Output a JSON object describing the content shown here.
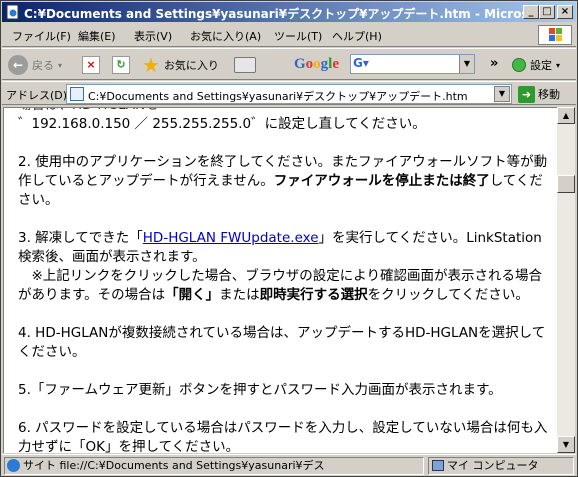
{
  "window": {
    "title": "C:¥Documents and Settings¥yasunari¥デスクトップ¥アップデート.htm - Microsoft Inter..."
  },
  "menu": {
    "items": [
      "ファイル(F)",
      "編集(E)",
      "表示(V)",
      "お気に入り(A)",
      "ツール(T)",
      "ヘルプ(H)"
    ]
  },
  "toolbar": {
    "back_label": "戻る",
    "favorites_label": "お気に入り",
    "google_label": "Google",
    "settings_label": "設定",
    "more": "»"
  },
  "address": {
    "label": "アドレス(D)",
    "url": "C:¥Documents and Settings¥yasunari¥デスクトップ¥アップデート.htm",
    "go_label": "移動"
  },
  "content": {
    "partial_top": "場合は、HD-HGLANを",
    "line_ip": "゛192.168.0.150 ／ 255.255.255.0゛に設定し直してください。",
    "step2_text": "2. 使用中のアプリケーションを終了してください。またファイアウォールソフト等が動作しているとアップデートが行えません。",
    "step2_bold": "ファイアウォールを停止または終了",
    "step2_end": "してください。",
    "step3_pre": "3. 解凍してできた「",
    "step3_link": "HD-HGLAN FWUpdate.exe",
    "step3_post": "」を実行してください。LinkStation検索後、画面が表示されます。",
    "step3_note_a": "　※上記リンクをクリックした場合、ブラウザの設定により確認画面が表示される場合があります。その場合は",
    "step3_note_b1": "「開く」",
    "step3_note_c": "または",
    "step3_note_b2": "即時実行する選択",
    "step3_note_d": "をクリックしてください。",
    "step4": "4. HD-HGLANが複数接続されている場合は、アップデートするHD-HGLANを選択してください。",
    "step5": "5.「ファームウェア更新」ボタンを押すとパスワード入力画面が表示されます。",
    "step6": "6. パスワードを設定している場合はパスワードを入力し、設定していない場合は何も入力せずに「OK」を押してください。"
  },
  "status": {
    "text": "サイト file://C:¥Documents and Settings¥yasunari¥デス",
    "zone": "マイ コンピュータ"
  },
  "colors": {
    "title_start": "#0a246a",
    "title_end": "#a6caf0",
    "link": "#0000cc",
    "chrome": "#d4d0c8"
  }
}
